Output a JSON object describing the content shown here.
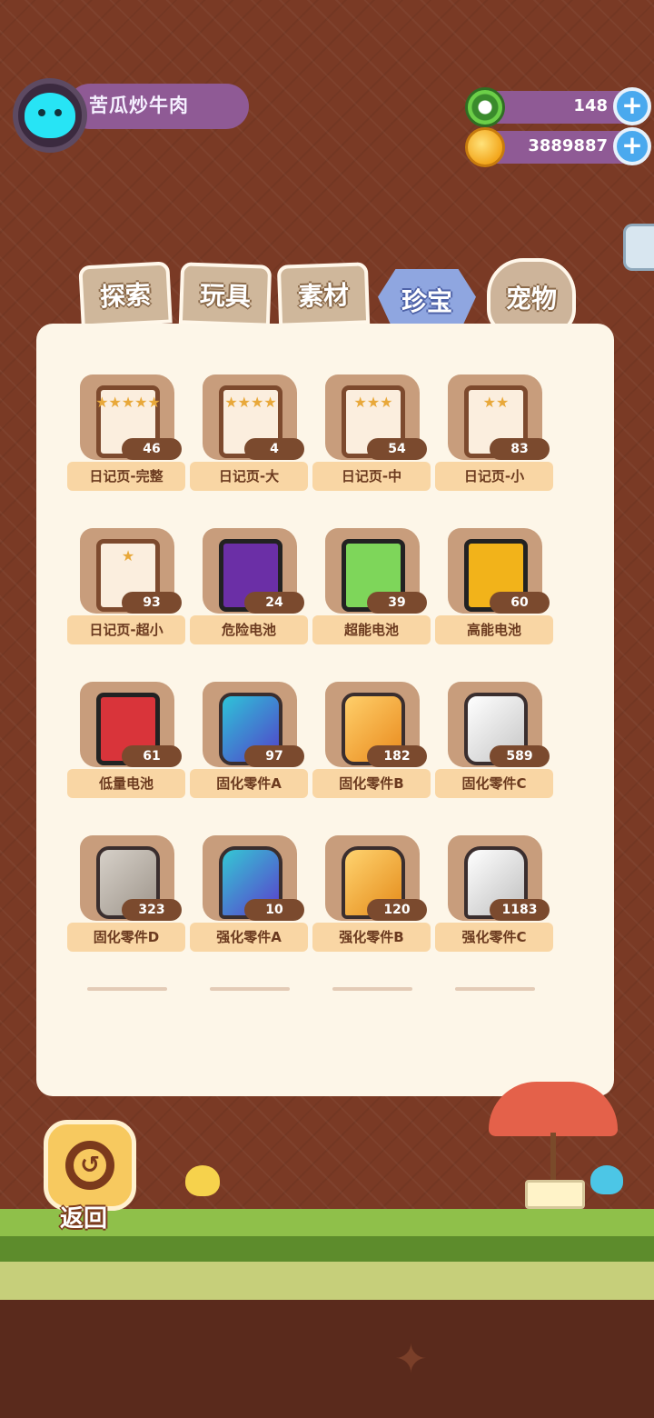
{
  "player": {
    "name": "苦瓜炒牛肉"
  },
  "currencies": [
    {
      "icon": "green-gem-icon",
      "value": "148"
    },
    {
      "icon": "gold-coin-icon",
      "value": "3889887"
    }
  ],
  "tabs": [
    "探索",
    "玩具",
    "素材",
    "珍宝",
    "宠物"
  ],
  "items": [
    {
      "label": "日记页-完整",
      "count": "46",
      "icon": "diary-page-icon",
      "stars": "★★★★★"
    },
    {
      "label": "日记页-大",
      "count": "4",
      "icon": "diary-page-icon",
      "stars": "★★★★"
    },
    {
      "label": "日记页-中",
      "count": "54",
      "icon": "diary-page-icon",
      "stars": "★★★"
    },
    {
      "label": "日记页-小",
      "count": "83",
      "icon": "diary-page-icon",
      "stars": "★★"
    },
    {
      "label": "日记页-超小",
      "count": "93",
      "icon": "diary-page-icon",
      "stars": "★"
    },
    {
      "label": "危险电池",
      "count": "24",
      "icon": "danger-battery-icon"
    },
    {
      "label": "超能电池",
      "count": "39",
      "icon": "super-battery-icon"
    },
    {
      "label": "高能电池",
      "count": "60",
      "icon": "high-battery-icon"
    },
    {
      "label": "低量电池",
      "count": "61",
      "icon": "low-battery-icon"
    },
    {
      "label": "固化零件A",
      "count": "97",
      "icon": "nut-icon"
    },
    {
      "label": "固化零件B",
      "count": "182",
      "icon": "nut-icon"
    },
    {
      "label": "固化零件C",
      "count": "589",
      "icon": "nut-icon"
    },
    {
      "label": "固化零件D",
      "count": "323",
      "icon": "nut-icon"
    },
    {
      "label": "强化零件A",
      "count": "10",
      "icon": "bolt-icon"
    },
    {
      "label": "强化零件B",
      "count": "120",
      "icon": "bolt-icon"
    },
    {
      "label": "强化零件C",
      "count": "1183",
      "icon": "bolt-icon"
    }
  ],
  "back_label": "返回",
  "colors": {
    "background": "#7a3a25",
    "panel": "#fdf6e8",
    "pill": "#8f5a95",
    "plus": "#4aa9ee",
    "label_bg": "#f9d6a4"
  }
}
